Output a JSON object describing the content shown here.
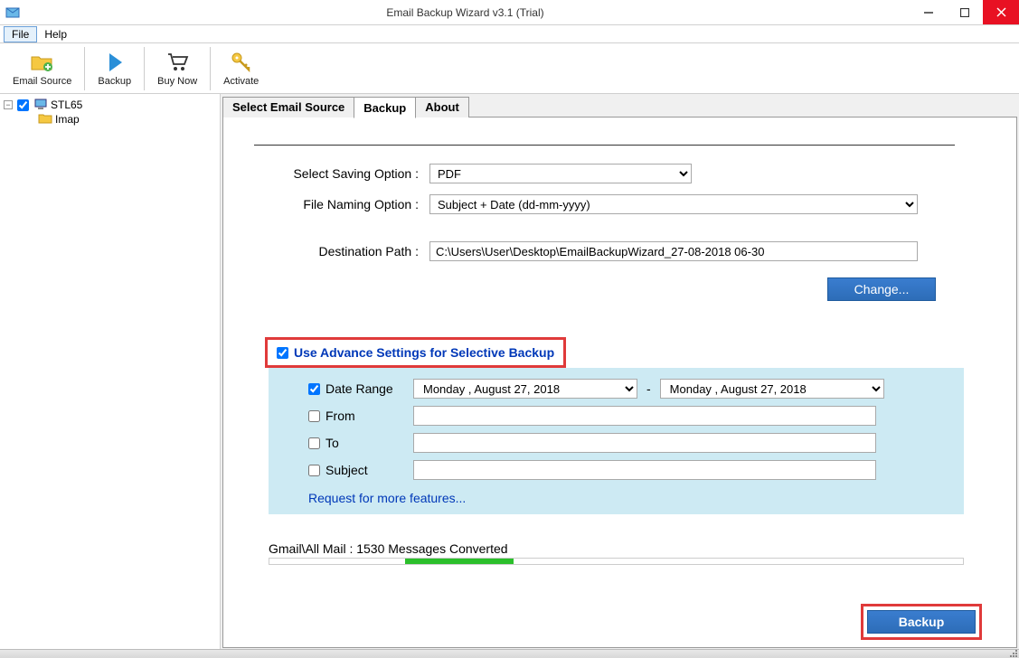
{
  "window": {
    "title": "Email Backup Wizard v3.1 (Trial)"
  },
  "menu": {
    "file": "File",
    "help": "Help"
  },
  "toolbar": {
    "email_source": "Email Source",
    "backup": "Backup",
    "buy_now": "Buy Now",
    "activate": "Activate"
  },
  "tree": {
    "root": "STL65",
    "child": "Imap"
  },
  "tabs": {
    "select_source": "Select Email Source",
    "backup": "Backup",
    "about": "About"
  },
  "form": {
    "saving_label": "Select Saving Option :",
    "saving_value": "PDF",
    "naming_label": "File Naming Option :",
    "naming_value": "Subject + Date (dd-mm-yyyy)",
    "dest_label": "Destination Path :",
    "dest_value": "C:\\Users\\User\\Desktop\\EmailBackupWizard_27-08-2018 06-30",
    "change_btn": "Change..."
  },
  "advance": {
    "label": "Use Advance Settings for Selective Backup"
  },
  "filters": {
    "date_range_label": "Date Range",
    "date_from": "Monday   ,   August   27, 2018",
    "date_to": "Monday   ,   August   27, 2018",
    "from_label": "From",
    "to_label": "To",
    "subject_label": "Subject",
    "more_link": "Request for more features..."
  },
  "status": {
    "text": "Gmail\\All Mail : 1530 Messages Converted"
  },
  "footer": {
    "backup_btn": "Backup"
  }
}
